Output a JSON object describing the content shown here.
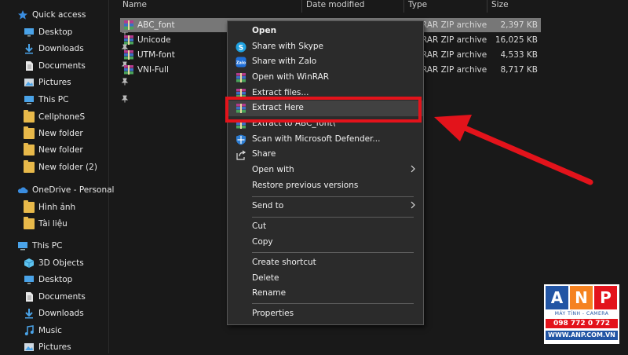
{
  "sidebar": {
    "items": [
      {
        "label": "Quick access",
        "icon": "star-icon",
        "pinned": false
      },
      {
        "label": "Desktop",
        "icon": "desktop-icon",
        "pinned": true
      },
      {
        "label": "Downloads",
        "icon": "download-arrow-icon",
        "pinned": true
      },
      {
        "label": "Documents",
        "icon": "document-icon",
        "pinned": true
      },
      {
        "label": "Pictures",
        "icon": "pictures-icon",
        "pinned": true
      },
      {
        "label": "This PC",
        "icon": "computer-icon",
        "pinned": true
      },
      {
        "label": "CellphoneS",
        "icon": "folder-icon",
        "pinned": false
      },
      {
        "label": "New folder",
        "icon": "folder-icon",
        "pinned": false
      },
      {
        "label": "New folder",
        "icon": "folder-icon",
        "pinned": false
      },
      {
        "label": "New folder (2)",
        "icon": "folder-icon",
        "pinned": false
      },
      {
        "label": "OneDrive - Personal",
        "icon": "cloud-icon",
        "pinned": false
      },
      {
        "label": "Hình ảnh",
        "icon": "folder-icon",
        "pinned": false
      },
      {
        "label": "Tài liệu",
        "icon": "folder-icon",
        "pinned": false
      },
      {
        "label": "This PC",
        "icon": "computer-icon",
        "pinned": false
      },
      {
        "label": "3D Objects",
        "icon": "cube-icon",
        "pinned": false
      },
      {
        "label": "Desktop",
        "icon": "desktop-icon",
        "pinned": false
      },
      {
        "label": "Documents",
        "icon": "document-icon",
        "pinned": false
      },
      {
        "label": "Downloads",
        "icon": "download-arrow-icon",
        "pinned": false
      },
      {
        "label": "Music",
        "icon": "music-note-icon",
        "pinned": false
      },
      {
        "label": "Pictures",
        "icon": "pictures-icon",
        "pinned": false
      }
    ]
  },
  "file_list": {
    "columns": [
      "Name",
      "Date modified",
      "Type",
      "Size"
    ],
    "rows": [
      {
        "name": "ABC_font",
        "type": "RAR ZIP archive",
        "size": "2,397 KB",
        "selected": true
      },
      {
        "name": "Unicode",
        "type": "RAR ZIP archive",
        "size": "16,025 KB",
        "selected": false
      },
      {
        "name": "UTM-font",
        "type": "RAR ZIP archive",
        "size": "4,533 KB",
        "selected": false
      },
      {
        "name": "VNI-Full",
        "type": "RAR ZIP archive",
        "size": "8,717 KB",
        "selected": false
      }
    ]
  },
  "context_menu": {
    "items": [
      {
        "label": "Open",
        "icon": "",
        "bold": true
      },
      {
        "label": "Share with Skype",
        "icon": "skype-icon"
      },
      {
        "label": "Share with Zalo",
        "icon": "zalo-icon"
      },
      {
        "label": "Open with WinRAR",
        "icon": "winrar-icon"
      },
      {
        "label": "Extract files...",
        "icon": "winrar-icon"
      },
      {
        "label": "Extract Here",
        "icon": "winrar-icon",
        "highlighted": true
      },
      {
        "label": "Extract to ABC_font\\",
        "icon": "winrar-icon"
      },
      {
        "label": "Scan with Microsoft Defender...",
        "icon": "defender-shield-icon"
      },
      {
        "label": "Share",
        "icon": "share-icon"
      },
      {
        "label": "Open with",
        "icon": "",
        "submenu": true
      },
      {
        "label": "Restore previous versions",
        "icon": ""
      },
      {
        "label": "Send to",
        "icon": "",
        "submenu": true
      },
      {
        "label": "Cut",
        "icon": ""
      },
      {
        "label": "Copy",
        "icon": ""
      },
      {
        "label": "Create shortcut",
        "icon": ""
      },
      {
        "label": "Delete",
        "icon": ""
      },
      {
        "label": "Rename",
        "icon": ""
      },
      {
        "label": "Properties",
        "icon": ""
      }
    ]
  },
  "annotation": {
    "color": "#e3131b"
  },
  "logo": {
    "letters": [
      "A",
      "N",
      "P"
    ],
    "tagline": "MÁY TÍNH - CAMERA",
    "phone": "098 772 0 772",
    "website": "WWW.ANP.COM.VN"
  }
}
